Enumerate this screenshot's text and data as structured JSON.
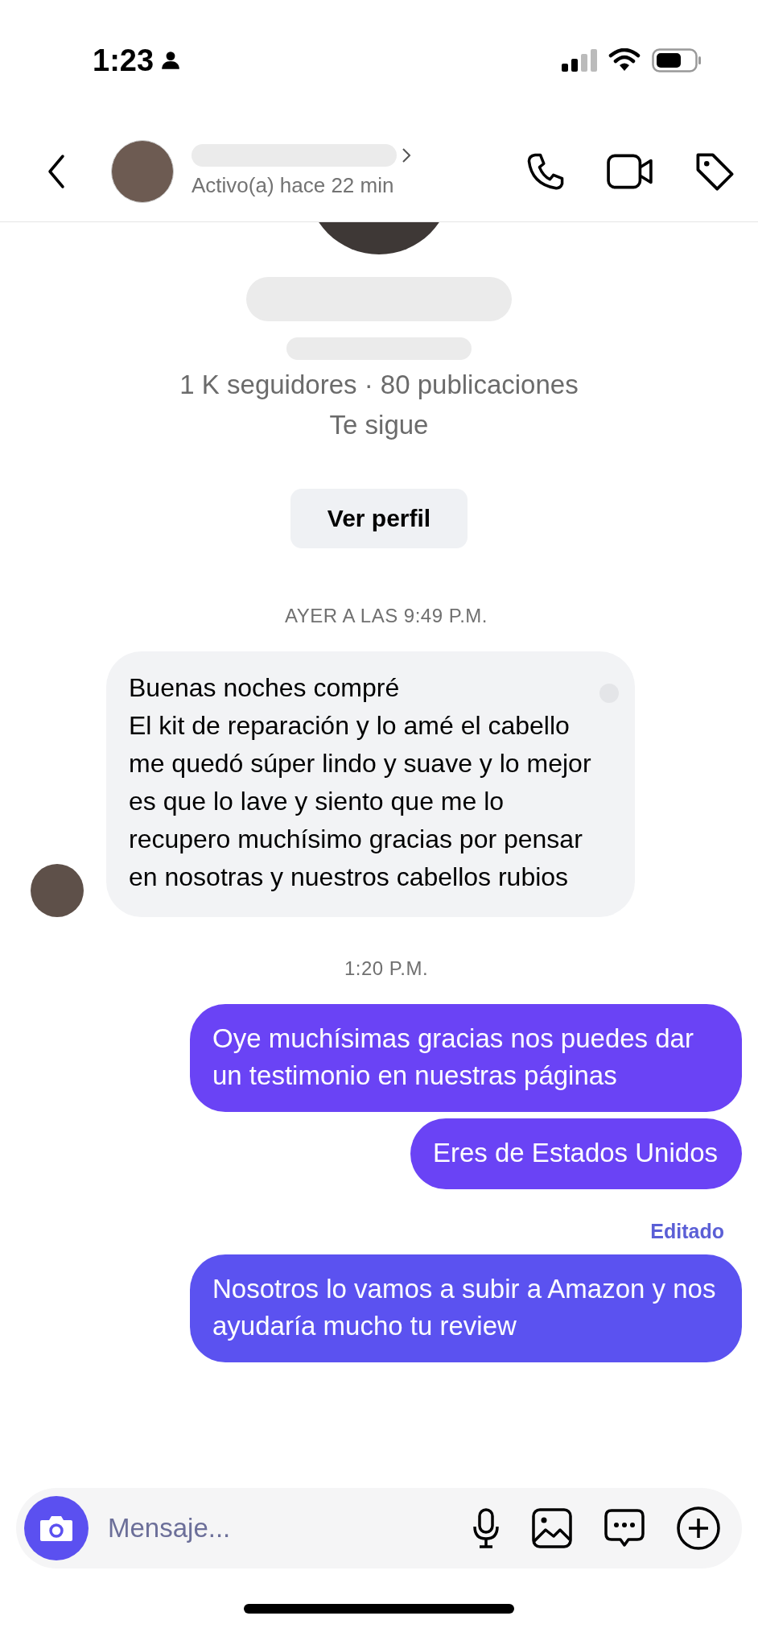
{
  "status_bar": {
    "time": "1:23"
  },
  "header": {
    "subtitle": "Activo(a) hace 22 min"
  },
  "profile": {
    "stats": "1 K seguidores · 80 publicaciones",
    "follow_status": "Te sigue",
    "button": "Ver perfil"
  },
  "messages": [
    {
      "kind": "timestamp",
      "text": "AYER A LAS 9:49 P.M."
    },
    {
      "kind": "incoming",
      "text": "Buenas noches compré\nEl kit de reparación y lo amé el cabello me quedó súper lindo y suave y lo mejor es que lo lave y siento que me lo recupero muchísimo gracias por pensar en nosotras y nuestros cabellos rubios"
    },
    {
      "kind": "timestamp",
      "text": "1:20 P.M."
    },
    {
      "kind": "outgoing",
      "text": "Oye muchísimas gracias nos puedes dar un testimonio en nuestras páginas"
    },
    {
      "kind": "outgoing",
      "text": "Eres de Estados Unidos"
    },
    {
      "kind": "edited",
      "text": "Editado"
    },
    {
      "kind": "outgoing",
      "text": "Nosotros lo vamos a subir a Amazon y nos ayudaría mucho tu review"
    }
  ],
  "composer": {
    "placeholder": "Mensaje..."
  }
}
